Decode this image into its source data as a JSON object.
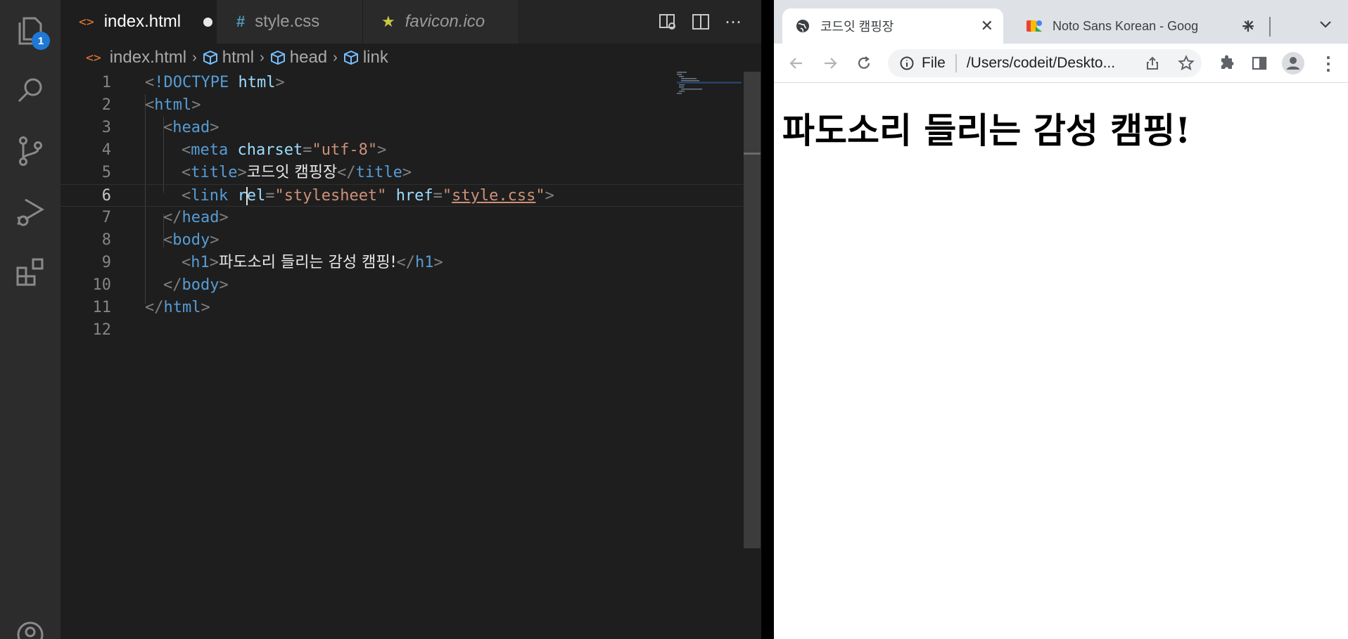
{
  "activity": {
    "explorer_badge": "1"
  },
  "editor_tabs": [
    {
      "label": "index.html",
      "icon": "<>"
    },
    {
      "label": "style.css",
      "icon": "#"
    },
    {
      "label": "favicon.ico",
      "icon": "★"
    }
  ],
  "breadcrumb": [
    "index.html",
    "html",
    "head",
    "link"
  ],
  "line_numbers": [
    "1",
    "2",
    "3",
    "4",
    "5",
    "6",
    "7",
    "8",
    "9",
    "10",
    "11",
    "12"
  ],
  "code": {
    "l1_doctype": "!DOCTYPE",
    "l1_html": "html",
    "html": "html",
    "head": "head",
    "meta": "meta",
    "charset_attr": "charset",
    "charset_val": "\"utf-8\"",
    "title_tag": "title",
    "title_text": "코드잇 캠핑장",
    "link_tag": "link",
    "rel_attr_a": "r",
    "rel_attr_b": "el",
    "rel_val": "\"stylesheet\"",
    "href_attr": "href",
    "href_q": "\"",
    "href_val": "style.css",
    "body": "body",
    "h1": "h1",
    "h1_text": "파도소리 들리는 감성 캠핑!"
  },
  "browser": {
    "tabs": [
      {
        "title": "코드잇 캠핑장"
      },
      {
        "title": "Noto Sans Korean - Goog"
      }
    ],
    "scheme_label": "File",
    "url": "/Users/codeit/Deskto...",
    "page_heading": "파도소리 들리는 감성 캠핑!"
  },
  "colors": {
    "accent": "#1e78d6",
    "tag": "#569cd6",
    "attr": "#9cdcfe",
    "string": "#ce9178"
  }
}
